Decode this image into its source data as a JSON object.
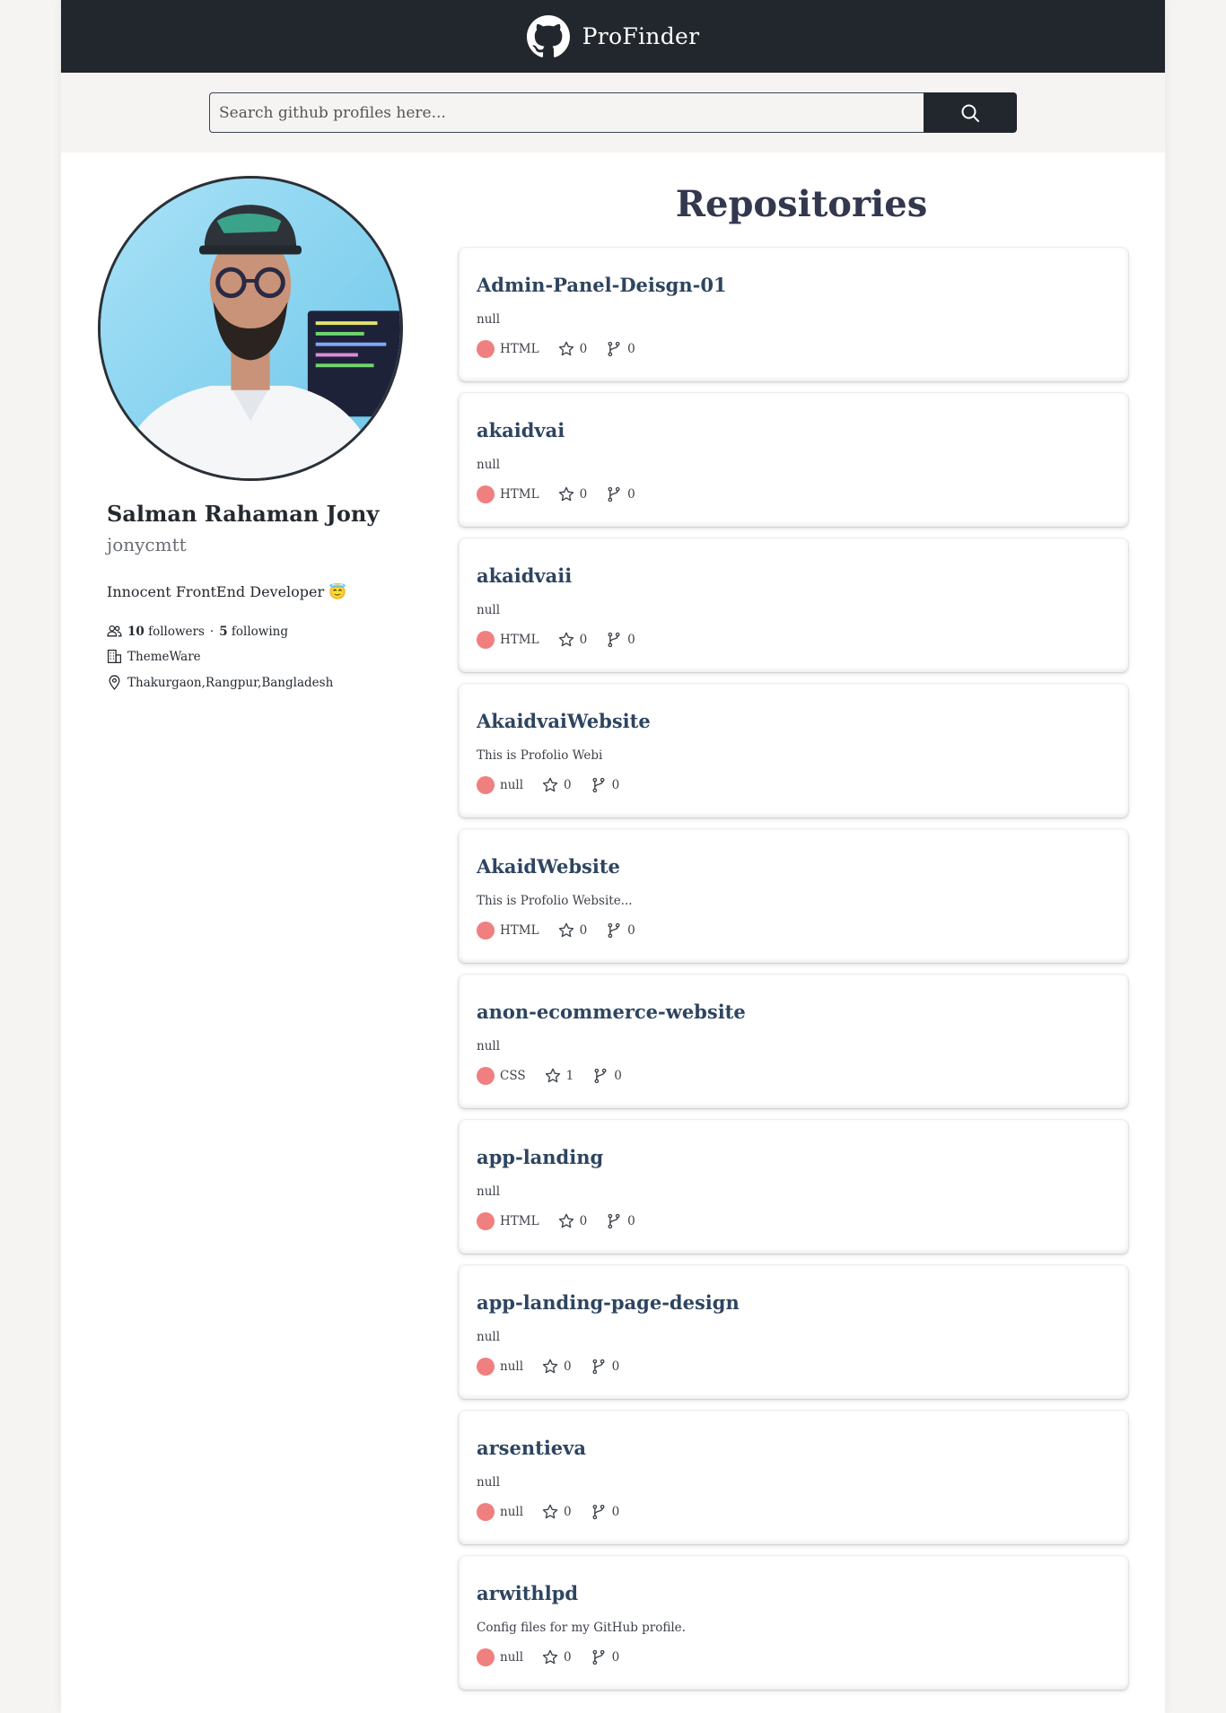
{
  "header": {
    "brand": "ProFinder",
    "logo_icon": "github-icon"
  },
  "search": {
    "placeholder": "Search github profiles here...",
    "value": "",
    "button_icon": "search-icon"
  },
  "profile": {
    "name": "Salman Rahaman Jony",
    "login": "jonycmtt",
    "bio": "Innocent FrontEnd Developer 😇",
    "followers_count": "10",
    "followers_label": "followers",
    "separator": "·",
    "following_count": "5",
    "following_label": "following",
    "company": "ThemeWare",
    "location": "Thakurgaon,Rangpur,Bangladesh"
  },
  "repositories": {
    "title": "Repositories",
    "items": [
      {
        "name": "Admin-Panel-Deisgn-01",
        "description": "null",
        "language": "HTML",
        "stars": "0",
        "forks": "0"
      },
      {
        "name": "akaidvai",
        "description": "null",
        "language": "HTML",
        "stars": "0",
        "forks": "0"
      },
      {
        "name": "akaidvaii",
        "description": "null",
        "language": "HTML",
        "stars": "0",
        "forks": "0"
      },
      {
        "name": "AkaidvaiWebsite",
        "description": "This is Profolio Webi",
        "language": "null",
        "stars": "0",
        "forks": "0"
      },
      {
        "name": "AkaidWebsite",
        "description": "This is Profolio Website...",
        "language": "HTML",
        "stars": "0",
        "forks": "0"
      },
      {
        "name": "anon-ecommerce-website",
        "description": "null",
        "language": "CSS",
        "stars": "1",
        "forks": "0"
      },
      {
        "name": "app-landing",
        "description": "null",
        "language": "HTML",
        "stars": "0",
        "forks": "0"
      },
      {
        "name": "app-landing-page-design",
        "description": "null",
        "language": "null",
        "stars": "0",
        "forks": "0"
      },
      {
        "name": "arsentieva",
        "description": "null",
        "language": "null",
        "stars": "0",
        "forks": "0"
      },
      {
        "name": "arwithlpd",
        "description": "Config files for my GitHub profile.",
        "language": "null",
        "stars": "0",
        "forks": "0"
      }
    ]
  },
  "colors": {
    "header_bg": "#22272e",
    "repo_name": "#2e4560",
    "repo_heading": "#33384f",
    "language_dot": "#f07f7f"
  }
}
